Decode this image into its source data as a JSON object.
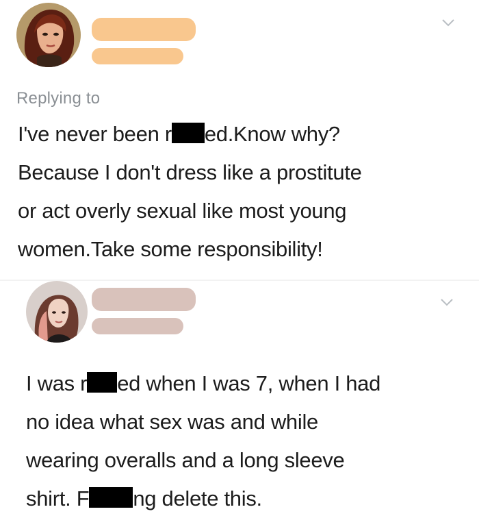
{
  "colors": {
    "name_bar_1": "#f9c78e",
    "name_bar_2": "#d9c2bb",
    "chevron": "#b9bec3",
    "censor": "#000000"
  },
  "tweet1": {
    "avatar_icon": "fantasy-woman-avatar-icon",
    "reply_label": "Replying to",
    "lines": [
      {
        "before": "I've never been r",
        "after": "ed.Know why?"
      },
      {
        "text": "Because I don't dress like a prostitute"
      },
      {
        "text": "or act overly sexual like most young"
      },
      {
        "text": "women.Take some responsibility!"
      }
    ]
  },
  "tweet2": {
    "avatar_icon": "woman-photo-avatar-icon",
    "lines": [
      {
        "before": "I was r",
        "after": "ed when I was 7, when I had"
      },
      {
        "text": "no idea what sex was and while"
      },
      {
        "text": "wearing overalls and a long sleeve"
      },
      {
        "before": "shirt. F",
        "after": "ng delete this."
      }
    ]
  }
}
